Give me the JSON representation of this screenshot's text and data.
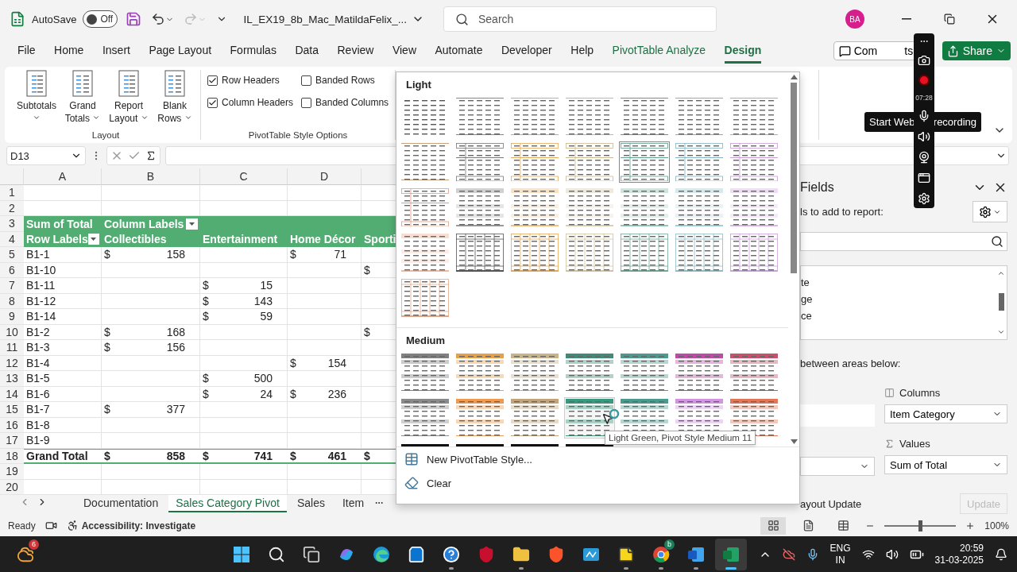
{
  "title_bar": {
    "autosave_label": "AutoSave",
    "autosave": {
      "on": false,
      "label": "Off"
    },
    "file_name": "IL_EX19_8b_Mac_MatildaFelix_...",
    "search": {
      "placeholder": "Search"
    },
    "avatar": "BA"
  },
  "menu_tabs": [
    {
      "label": "File",
      "kind": "normal",
      "selected": false
    },
    {
      "label": "Home",
      "kind": "normal",
      "selected": false
    },
    {
      "label": "Insert",
      "kind": "normal",
      "selected": false
    },
    {
      "label": "Page Layout",
      "kind": "normal",
      "selected": false
    },
    {
      "label": "Formulas",
      "kind": "normal",
      "selected": false
    },
    {
      "label": "Data",
      "kind": "normal",
      "selected": false
    },
    {
      "label": "Review",
      "kind": "normal",
      "selected": false
    },
    {
      "label": "View",
      "kind": "normal",
      "selected": false
    },
    {
      "label": "Automate",
      "kind": "normal",
      "selected": false
    },
    {
      "label": "Developer",
      "kind": "normal",
      "selected": false
    },
    {
      "label": "Help",
      "kind": "normal",
      "selected": false
    },
    {
      "label": "PivotTable Analyze",
      "kind": "contextual",
      "selected": false
    },
    {
      "label": "Design",
      "kind": "contextual",
      "selected": true
    }
  ],
  "comments_button": {
    "parts": [
      "Com",
      "ts"
    ]
  },
  "share_button": {
    "label": "Share"
  },
  "ribbon": {
    "layout_group": {
      "label": "Layout",
      "buttons": [
        {
          "label": "Subtotals"
        },
        {
          "label": "Grand Totals"
        },
        {
          "label": "Report Layout"
        },
        {
          "label": "Blank Rows"
        }
      ]
    },
    "style_options": {
      "label": "PivotTable Style Options",
      "options": [
        {
          "label": "Row Headers",
          "checked": true
        },
        {
          "label": "Banded Rows",
          "checked": false
        },
        {
          "label": "Column Headers",
          "checked": true
        },
        {
          "label": "Banded Columns",
          "checked": false
        }
      ]
    }
  },
  "recorder": {
    "time": "07:28",
    "tooltip_parts": [
      "Start Web",
      "recording"
    ]
  },
  "formula_bar": {
    "name_box": "D13"
  },
  "sheet": {
    "columns": [
      "A",
      "B",
      "C",
      "D"
    ],
    "rows": [
      {
        "n": "1",
        "kind": "blank",
        "cells": []
      },
      {
        "n": "2",
        "kind": "blank",
        "cells": []
      },
      {
        "n": "3",
        "kind": "header",
        "cells": [
          {
            "text": "Sum of Total"
          },
          {
            "text": "Column Labels",
            "filter": true
          }
        ]
      },
      {
        "n": "4",
        "kind": "header",
        "cells": [
          {
            "text": "Row Labels",
            "filter": true
          },
          {
            "text": "Collectibles"
          },
          {
            "text": "Entertainment"
          },
          {
            "text": "Home Décor"
          },
          {
            "text": "Sporti"
          }
        ]
      },
      {
        "n": "5",
        "kind": "data",
        "cells": [
          {
            "text": "B1-1"
          },
          {
            "currency": "$",
            "amount": "158"
          },
          null,
          {
            "currency": "$",
            "amount": "71"
          }
        ]
      },
      {
        "n": "6",
        "kind": "data",
        "cells": [
          {
            "text": "B1-10"
          },
          null,
          null,
          null,
          {
            "currency": "$"
          }
        ]
      },
      {
        "n": "7",
        "kind": "data",
        "cells": [
          {
            "text": "B1-11"
          },
          null,
          {
            "currency": "$",
            "amount": "15"
          }
        ]
      },
      {
        "n": "8",
        "kind": "data",
        "cells": [
          {
            "text": "B1-12"
          },
          null,
          {
            "currency": "$",
            "amount": "143"
          }
        ]
      },
      {
        "n": "9",
        "kind": "data",
        "cells": [
          {
            "text": "B1-14"
          },
          null,
          {
            "currency": "$",
            "amount": "59"
          }
        ]
      },
      {
        "n": "10",
        "kind": "data",
        "cells": [
          {
            "text": "B1-2"
          },
          {
            "currency": "$",
            "amount": "168"
          },
          null,
          null,
          {
            "currency": "$"
          }
        ]
      },
      {
        "n": "11",
        "kind": "data",
        "cells": [
          {
            "text": "B1-3"
          },
          {
            "currency": "$",
            "amount": "156"
          }
        ]
      },
      {
        "n": "12",
        "kind": "data",
        "cells": [
          {
            "text": "B1-4"
          },
          null,
          null,
          {
            "currency": "$",
            "amount": "154"
          }
        ]
      },
      {
        "n": "13",
        "kind": "data",
        "cells": [
          {
            "text": "B1-5"
          },
          null,
          {
            "currency": "$",
            "amount": "500"
          }
        ]
      },
      {
        "n": "14",
        "kind": "data",
        "cells": [
          {
            "text": "B1-6"
          },
          null,
          {
            "currency": "$",
            "amount": "24"
          },
          {
            "currency": "$",
            "amount": "236"
          }
        ]
      },
      {
        "n": "15",
        "kind": "data",
        "cells": [
          {
            "text": "B1-7"
          },
          {
            "currency": "$",
            "amount": "377"
          }
        ]
      },
      {
        "n": "16",
        "kind": "data",
        "cells": [
          {
            "text": "B1-8"
          }
        ]
      },
      {
        "n": "17",
        "kind": "data",
        "cells": [
          {
            "text": "B1-9"
          }
        ]
      },
      {
        "n": "18",
        "kind": "total",
        "cells": [
          {
            "text": "Grand Total"
          },
          {
            "currency": "$",
            "amount": "858"
          },
          {
            "currency": "$",
            "amount": "741"
          },
          {
            "currency": "$",
            "amount": "461"
          },
          {
            "currency": "$"
          }
        ]
      },
      {
        "n": "19",
        "kind": "blank",
        "cells": []
      },
      {
        "n": "20",
        "kind": "blank",
        "cells": []
      }
    ]
  },
  "sheet_tabs": [
    {
      "label": "Documentation",
      "selected": false
    },
    {
      "label": "Sales Category Pivot",
      "selected": true
    },
    {
      "label": "Sales",
      "selected": false
    },
    {
      "label": "Item",
      "selected": false
    }
  ],
  "style_gallery": {
    "sections": [
      {
        "title": "Light",
        "styles": [
          {
            "kind": "plain",
            "color": "#555555",
            "selected": false
          },
          {
            "kind": "lines",
            "color": "#888888",
            "selected": false
          },
          {
            "kind": "lines",
            "color": "#e3a857",
            "selected": false
          },
          {
            "kind": "lines",
            "color": "#c9b98a",
            "selected": false
          },
          {
            "kind": "lines",
            "color": "#5c9f8c",
            "selected": false
          },
          {
            "kind": "lines",
            "color": "#7fb3c0",
            "selected": false
          },
          {
            "kind": "lines",
            "color": "#c79ad6",
            "selected": false
          },
          {
            "kind": "lines",
            "color": "#c8a27a",
            "selected": false
          },
          {
            "kind": "boxed",
            "color": "#777777",
            "selected": false
          },
          {
            "kind": "boxed",
            "color": "#e3a857",
            "selected": false
          },
          {
            "kind": "boxed",
            "color": "#c9b98a",
            "selected": false
          },
          {
            "kind": "boxed",
            "color": "#5c9f8c",
            "selected": true
          },
          {
            "kind": "boxed",
            "color": "#7fb3c0",
            "selected": false
          },
          {
            "kind": "boxed",
            "color": "#c79ad6",
            "selected": false
          },
          {
            "kind": "boxed",
            "color": "#e59a80",
            "selected": false
          },
          {
            "kind": "banded",
            "color": "#999999",
            "selected": false
          },
          {
            "kind": "banded",
            "color": "#f0c080",
            "selected": false
          },
          {
            "kind": "banded",
            "color": "#d9d0b0",
            "selected": false
          },
          {
            "kind": "banded",
            "color": "#8fc8b4",
            "selected": false
          },
          {
            "kind": "banded",
            "color": "#9fd0d8",
            "selected": false
          },
          {
            "kind": "banded",
            "color": "#dbb4e8",
            "selected": false
          },
          {
            "kind": "banded",
            "color": "#f0b8a0",
            "selected": false
          },
          {
            "kind": "grid",
            "color": "#555555",
            "selected": false
          },
          {
            "kind": "grid",
            "color": "#e3a857",
            "selected": false
          },
          {
            "kind": "grid",
            "color": "#d0c4a0",
            "selected": false
          },
          {
            "kind": "grid",
            "color": "#6fa898",
            "selected": false
          },
          {
            "kind": "grid",
            "color": "#8fbcc4",
            "selected": false
          },
          {
            "kind": "grid",
            "color": "#c9a0d8",
            "selected": false
          },
          {
            "kind": "grid",
            "color": "#e0a888",
            "selected": false
          }
        ]
      },
      {
        "title": "Medium",
        "styles": [
          {
            "kind": "header",
            "color": "#808080",
            "selected": false,
            "hovered": false
          },
          {
            "kind": "header",
            "color": "#e8a048",
            "selected": false,
            "hovered": false
          },
          {
            "kind": "header",
            "color": "#c9b48a",
            "selected": false,
            "hovered": false
          },
          {
            "kind": "header",
            "color": "#3f8b77",
            "selected": false,
            "hovered": false
          },
          {
            "kind": "header",
            "color": "#4a9a8f",
            "selected": false,
            "hovered": false
          },
          {
            "kind": "header",
            "color": "#c04aa8",
            "selected": false,
            "hovered": false
          },
          {
            "kind": "header",
            "color": "#c8506a",
            "selected": false,
            "hovered": false
          },
          {
            "kind": "header",
            "color": "#8a8a8a",
            "selected": false,
            "hovered": false
          },
          {
            "kind": "header",
            "color": "#ee9a50",
            "selected": false,
            "hovered": false
          },
          {
            "kind": "header",
            "color": "#c2a47a",
            "selected": false,
            "hovered": false
          },
          {
            "kind": "header",
            "color": "#3a9a80",
            "selected": false,
            "hovered": true
          },
          {
            "kind": "header",
            "color": "#4a9a90",
            "selected": false,
            "hovered": false
          },
          {
            "kind": "header",
            "color": "#d394e4",
            "selected": false,
            "hovered": false
          },
          {
            "kind": "header",
            "color": "#e07858",
            "selected": false,
            "hovered": false
          },
          {
            "kind": "cut",
            "color": "#111111",
            "selected": false,
            "hovered": false
          },
          {
            "kind": "cut",
            "color": "#111111",
            "selected": false,
            "hovered": false
          },
          {
            "kind": "cut",
            "color": "#111111",
            "selected": false,
            "hovered": false
          },
          {
            "kind": "cut",
            "color": "#111111",
            "selected": false,
            "hovered": false
          }
        ]
      }
    ],
    "tooltip": "Light Green, Pivot Style Medium 11",
    "actions": [
      {
        "kind": "new",
        "label": "New PivotTable Style..."
      },
      {
        "kind": "clear",
        "label": "Clear"
      }
    ]
  },
  "field_pane": {
    "title": "Fields",
    "hint": "ls to add to report:",
    "fields": [
      "te",
      "ge",
      "ce"
    ],
    "areas_hint": "between areas below:",
    "areas": [
      {
        "kind": "columns",
        "label": "Columns",
        "item": "Item Category"
      },
      {
        "kind": "values",
        "label": "Values",
        "item": "Sum of Total"
      }
    ],
    "defer_label": "ayout Update",
    "update_button": {
      "label": "Update",
      "disabled": true
    }
  },
  "status_bar": {
    "status": "Ready",
    "accessibility": "Accessibility: Investigate",
    "zoom": {
      "level": 0.5,
      "label": "100%"
    }
  },
  "taskbar": {
    "weather_badge": "6",
    "apps": [
      {
        "kind": "start",
        "running": false,
        "selected": false
      },
      {
        "kind": "search",
        "running": false,
        "selected": false
      },
      {
        "kind": "taskview",
        "running": false,
        "selected": false
      },
      {
        "kind": "copilot",
        "running": false,
        "selected": false
      },
      {
        "kind": "edge",
        "running": false,
        "selected": false
      },
      {
        "kind": "store",
        "running": false,
        "selected": false
      },
      {
        "kind": "help",
        "running": true,
        "selected": false
      },
      {
        "kind": "shield",
        "running": false,
        "selected": false
      },
      {
        "kind": "files",
        "running": true,
        "selected": false
      },
      {
        "kind": "lion",
        "running": false,
        "selected": false
      },
      {
        "kind": "tile",
        "running": false,
        "selected": false
      },
      {
        "kind": "note",
        "running": true,
        "selected": false
      },
      {
        "kind": "chrome",
        "running": true,
        "selected": false,
        "badge": "b"
      },
      {
        "kind": "word",
        "running": true,
        "selected": false
      },
      {
        "kind": "excel",
        "running": true,
        "selected": true
      }
    ],
    "language": [
      "ENG",
      "IN"
    ],
    "time": "20:59",
    "date": "31-03-2025"
  }
}
